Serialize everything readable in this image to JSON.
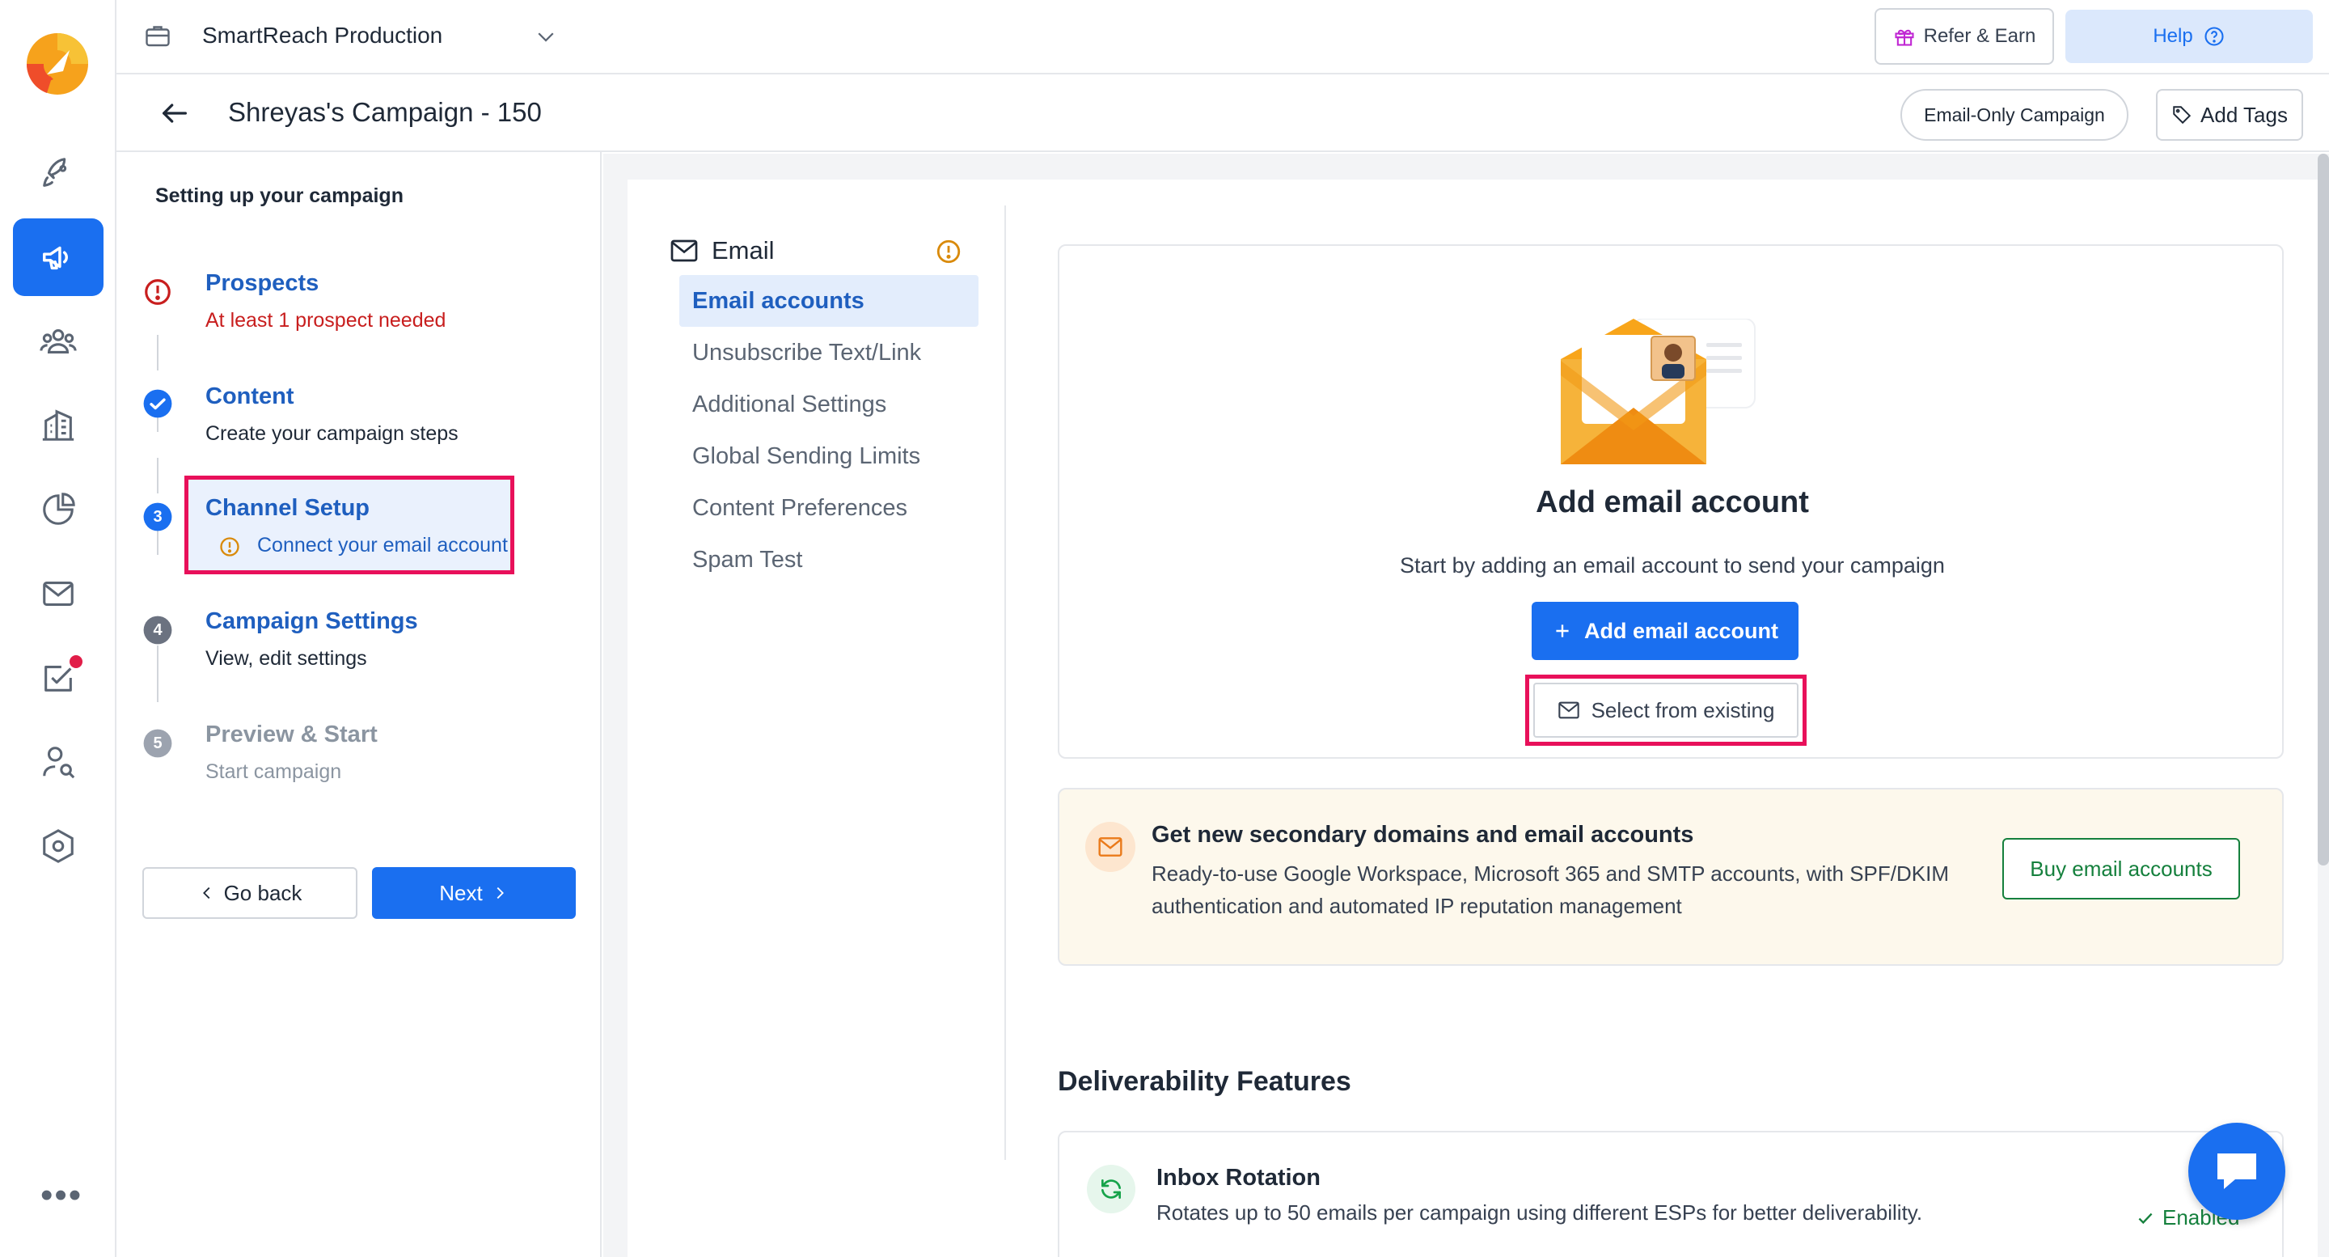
{
  "workspace": {
    "name": "SmartReach Production"
  },
  "topbar": {
    "refer_label": "Refer & Earn",
    "help_label": "Help"
  },
  "campaign": {
    "title": "Shreyas's Campaign - 150",
    "type_badge": "Email-Only Campaign",
    "add_tags_label": "Add Tags"
  },
  "steps_panel": {
    "heading": "Setting up your campaign",
    "steps": [
      {
        "title": "Prospects",
        "subtitle": "At least 1 prospect needed",
        "status": "error"
      },
      {
        "title": "Content",
        "subtitle": "Create your campaign steps",
        "status": "done"
      },
      {
        "number": "3",
        "title": "Channel Setup",
        "subtitle": "Connect your email account",
        "status": "current"
      },
      {
        "number": "4",
        "title": "Campaign Settings",
        "subtitle": "View, edit settings",
        "status": "pending"
      },
      {
        "number": "5",
        "title": "Preview & Start",
        "subtitle": "Start campaign",
        "status": "disabled"
      }
    ],
    "go_back_label": "Go back",
    "next_label": "Next"
  },
  "channel_nav": {
    "heading": "Email",
    "items": [
      {
        "label": "Email accounts",
        "active": true
      },
      {
        "label": "Unsubscribe Text/Link",
        "active": false
      },
      {
        "label": "Additional Settings",
        "active": false
      },
      {
        "label": "Global Sending Limits",
        "active": false
      },
      {
        "label": "Content Preferences",
        "active": false
      },
      {
        "label": "Spam Test",
        "active": false
      }
    ]
  },
  "add_account": {
    "title": "Add email account",
    "subtitle": "Start by adding an email account to send your campaign",
    "primary_label": "Add email account",
    "secondary_label": "Select from existing"
  },
  "promo": {
    "title": "Get new secondary domains and email accounts",
    "description": "Ready-to-use Google Workspace, Microsoft 365 and SMTP accounts, with SPF/DKIM authentication and automated IP reputation management",
    "button_label": "Buy email accounts"
  },
  "deliverability": {
    "title": "Deliverability Features",
    "features": [
      {
        "title": "Inbox Rotation",
        "description": "Rotates up to 50 emails per campaign using different ESPs for better deliverability.",
        "status": "Enabled"
      }
    ]
  },
  "colors": {
    "primary": "#1a6ff0",
    "highlight_border": "#e8105a",
    "error": "#c81e1e",
    "warning": "#d98a0b",
    "success": "#15803d"
  },
  "icons": {
    "rail": [
      "rocket-icon",
      "megaphone-icon",
      "users-icon",
      "building-icon",
      "pie-chart-icon",
      "mail-icon",
      "task-check-icon",
      "user-search-icon",
      "settings-hex-icon",
      "more-icon"
    ]
  }
}
